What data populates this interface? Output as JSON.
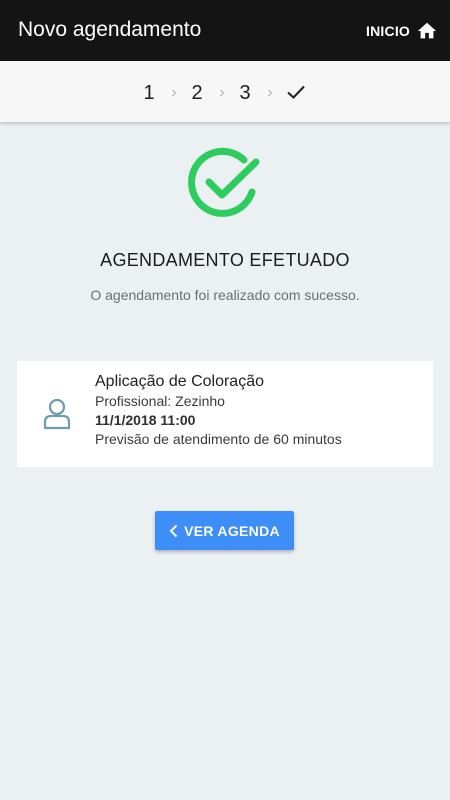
{
  "header": {
    "title": "Novo agendamento",
    "home_label": "INICIO",
    "home_icon": "home-icon"
  },
  "stepper": {
    "steps": [
      "1",
      "2",
      "3"
    ],
    "current": "done",
    "separator": "›",
    "final_icon": "check-icon"
  },
  "result": {
    "icon": "check-circle-icon",
    "color": "#2ecc5f",
    "title": "AGENDAMENTO EFETUADO",
    "message": "O agendamento foi realizado com sucesso."
  },
  "appointment": {
    "avatar_icon": "user-icon",
    "service": "Aplicação de Coloração",
    "professional": "Profissional: Zezinho",
    "datetime": "11/1/2018 11:00",
    "duration": "Previsão de atendimento de 60 minutos"
  },
  "actions": {
    "view_schedule_label": "VER AGENDA",
    "view_schedule_icon": "chevron-left-icon",
    "accent": "#3e8ef7"
  }
}
